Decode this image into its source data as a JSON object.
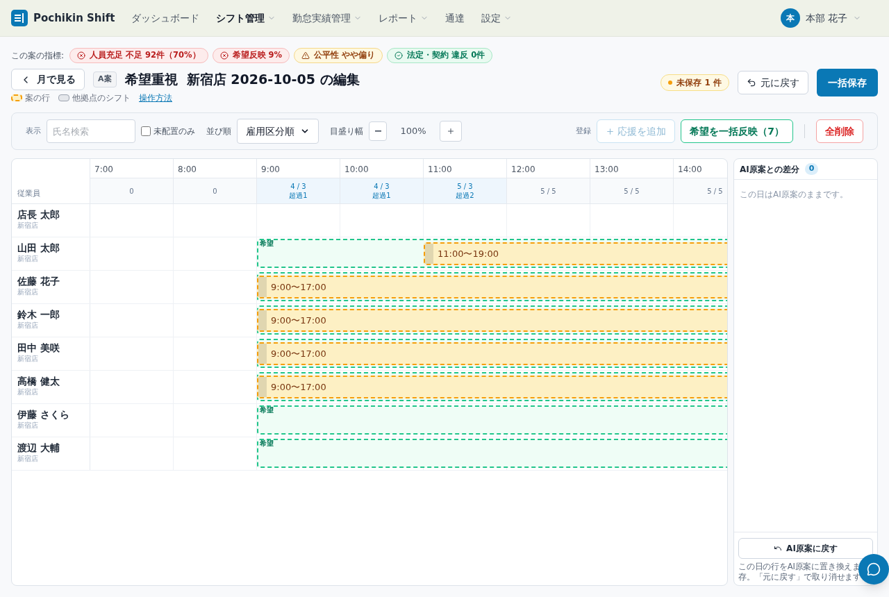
{
  "app": {
    "name": "Pochikin Shift"
  },
  "nav": [
    {
      "label": "ダッシュボード",
      "selected": false,
      "dropdown": false
    },
    {
      "label": "シフト管理",
      "selected": true,
      "dropdown": true
    },
    {
      "label": "勤怠実績管理",
      "selected": false,
      "dropdown": true
    },
    {
      "label": "レポート",
      "selected": false,
      "dropdown": true
    },
    {
      "label": "通達",
      "selected": false,
      "dropdown": false
    },
    {
      "label": "設定",
      "selected": false,
      "dropdown": true
    }
  ],
  "user": {
    "initial": "本",
    "name": "本部 花子"
  },
  "indicators": {
    "label": "この案の指標:",
    "items": [
      {
        "kind": "error",
        "text": "人員充足 不足 92件（70%）"
      },
      {
        "kind": "error",
        "text": "希望反映 9%"
      },
      {
        "kind": "warning",
        "text": "公平性 やや偏り"
      },
      {
        "kind": "ok",
        "text": "法定・契約 違反 0件"
      }
    ]
  },
  "header": {
    "back": "月で見る",
    "plan_badge": "A案",
    "title": "希望重視  新宿店 2026-10-05 の編集",
    "unsaved": "未保存 1 件",
    "undo": "元に戻す",
    "save": "一括保存",
    "legend": [
      {
        "kind": "draft",
        "label": "案の行"
      },
      {
        "kind": "other",
        "label": "他拠点のシフト"
      }
    ],
    "help_link": "操作方法"
  },
  "toolbar": {
    "display_label": "表示",
    "search_placeholder": "氏名検索",
    "unassigned_only": {
      "label": "未配置のみ",
      "checked": false
    },
    "sort_label": "並び順",
    "sort_value": "雇用区分順",
    "scale_label": "目盛り幅",
    "scale_value": "100%",
    "register_label": "登録",
    "add_support": {
      "label": "応援を追加",
      "disabled": true
    },
    "apply_hopes": "希望を一括反映（7）",
    "delete_all": "全削除"
  },
  "timeline": {
    "employee_header": "従業員",
    "hours": [
      "7:00",
      "8:00",
      "9:00",
      "10:00",
      "11:00",
      "12:00",
      "13:00",
      "14:00"
    ],
    "coverage": [
      {
        "text": "0",
        "over": false
      },
      {
        "text": "0",
        "over": false
      },
      {
        "text": "4 / 3",
        "sub": "超過1",
        "over": true
      },
      {
        "text": "4 / 3",
        "sub": "超過1",
        "over": true
      },
      {
        "text": "5 / 3",
        "sub": "超過2",
        "over": true
      },
      {
        "text": "5 / 5",
        "over": false
      },
      {
        "text": "5 / 5",
        "over": false
      },
      {
        "text": "5 / 5",
        "over": false
      }
    ],
    "rows": [
      {
        "name": "店長 太郎",
        "store": "新宿店"
      },
      {
        "name": "山田 太郎",
        "store": "新宿店",
        "hope": {
          "label": "希望"
        },
        "shift": {
          "label": "11:00〜19:00",
          "kind": "late"
        }
      },
      {
        "name": "佐藤 花子",
        "store": "新宿店",
        "hope": {},
        "shift": {
          "label": "9:00〜17:00",
          "kind": "early"
        }
      },
      {
        "name": "鈴木 一郎",
        "store": "新宿店",
        "hope": {},
        "shift": {
          "label": "9:00〜17:00",
          "kind": "early"
        }
      },
      {
        "name": "田中 美咲",
        "store": "新宿店",
        "hope": {},
        "shift": {
          "label": "9:00〜17:00",
          "kind": "early"
        }
      },
      {
        "name": "高橋 健太",
        "store": "新宿店",
        "hope": {},
        "shift": {
          "label": "9:00〜17:00",
          "kind": "early"
        }
      },
      {
        "name": "伊藤 さくら",
        "store": "新宿店",
        "hope": {
          "label": "希望"
        }
      },
      {
        "name": "渡辺 大輔",
        "store": "新宿店",
        "hope": {
          "label": "希望"
        }
      }
    ]
  },
  "diff_panel": {
    "title": "AI原案との差分",
    "count": "0",
    "empty": "この日はAI原案のままです。",
    "revert": "AI原案に戻す",
    "note_lines": [
      "この日の行をAI原案に置き換えま",
      "存。「元に戻す」で取り消せます"
    ]
  }
}
